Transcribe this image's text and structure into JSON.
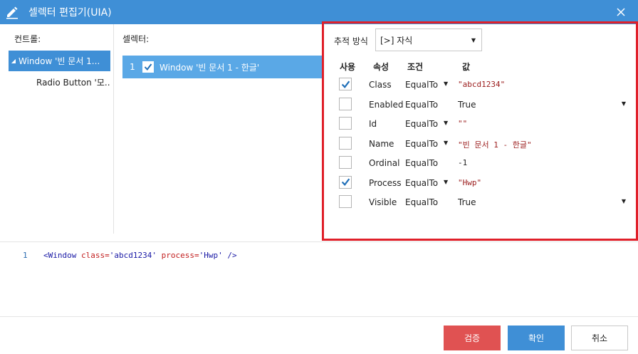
{
  "window": {
    "title": "셀렉터 편집기(UIA)"
  },
  "controls": {
    "header": "컨트롤:",
    "items": [
      {
        "label": "Window '빈 문서 1..."
      },
      {
        "label": "Radio Button '모..."
      }
    ]
  },
  "selectors": {
    "header": "셀렉터:",
    "items": [
      {
        "num": "1",
        "label": "Window '빈 문서 1 - 한글'"
      }
    ]
  },
  "trace": {
    "label": "추적 방식",
    "value": "[>] 자식"
  },
  "attr_table": {
    "headers": {
      "use": "사용",
      "attr": "속성",
      "cond": "조건",
      "value": "값"
    },
    "rows": [
      {
        "checked": true,
        "attr": "Class",
        "cond": "EqualTo",
        "cond_dropdown": true,
        "value": "\"abcd1234\"",
        "value_type": "str",
        "value_dropdown": false
      },
      {
        "checked": false,
        "attr": "Enabled",
        "cond": "EqualTo",
        "cond_dropdown": false,
        "value": "True",
        "value_type": "plain",
        "value_dropdown": true
      },
      {
        "checked": false,
        "attr": "Id",
        "cond": "EqualTo",
        "cond_dropdown": true,
        "value": "\"\"",
        "value_type": "str",
        "value_dropdown": false
      },
      {
        "checked": false,
        "attr": "Name",
        "cond": "EqualTo",
        "cond_dropdown": true,
        "value": "\"빈 문서 1 - 한글\"",
        "value_type": "str",
        "value_dropdown": false
      },
      {
        "checked": false,
        "attr": "Ordinal",
        "cond": "EqualTo",
        "cond_dropdown": false,
        "value": "-1",
        "value_type": "num",
        "value_dropdown": false
      },
      {
        "checked": true,
        "attr": "Process",
        "cond": "EqualTo",
        "cond_dropdown": true,
        "value": "\"Hwp\"",
        "value_type": "str",
        "value_dropdown": false
      },
      {
        "checked": false,
        "attr": "Visible",
        "cond": "EqualTo",
        "cond_dropdown": false,
        "value": "True",
        "value_type": "plain",
        "value_dropdown": true
      }
    ]
  },
  "code": {
    "line_number": "1",
    "tag_open": "<Window",
    "attr1": "class=",
    "val1": "'abcd1234'",
    "attr2": "process=",
    "val2": "'Hwp'",
    "tag_close": "/>"
  },
  "buttons": {
    "validate": "검증",
    "ok": "확인",
    "cancel": "취소"
  },
  "colors": {
    "titlebar": "#3f8fd6",
    "selected": "#3f8fd6",
    "highlight_border": "#e0202a",
    "validate_button": "#e05252",
    "check": "#1f6fb8"
  }
}
